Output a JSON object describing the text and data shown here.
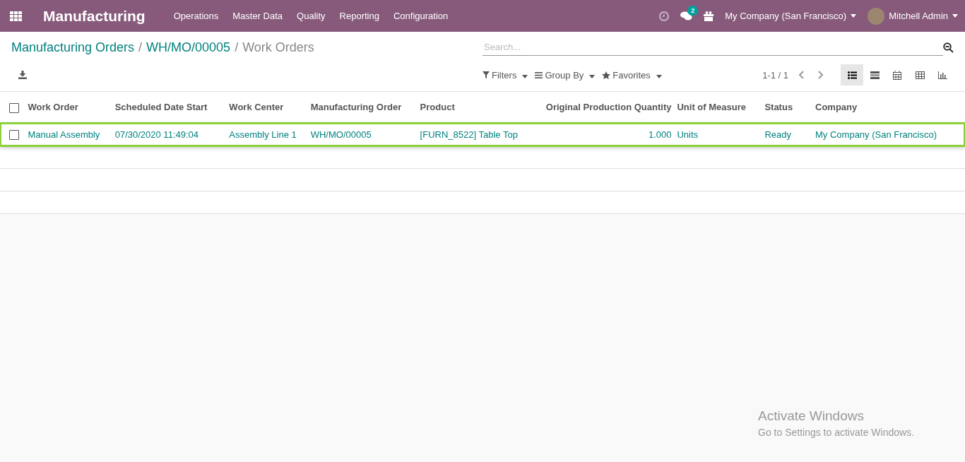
{
  "navbar": {
    "app_name": "Manufacturing",
    "menus": [
      "Operations",
      "Master Data",
      "Quality",
      "Reporting",
      "Configuration"
    ],
    "messages_count": "2",
    "company": "My Company (San Francisco)",
    "user": "Mitchell Admin"
  },
  "breadcrumb_separator": "/",
  "breadcrumb": [
    {
      "label": "Manufacturing Orders",
      "kind": "link"
    },
    {
      "label": "WH/MO/00005",
      "kind": "link"
    },
    {
      "label": "Work Orders",
      "kind": "current"
    }
  ],
  "search": {
    "placeholder": "Search..."
  },
  "filters": [
    {
      "label": "Filters",
      "kind": "filter"
    },
    {
      "label": "Group By",
      "kind": "group"
    },
    {
      "label": "Favorites",
      "kind": "star"
    }
  ],
  "pager": "1-1 / 1",
  "views": [
    {
      "kind": "list",
      "selected": true
    },
    {
      "kind": "kanban",
      "selected": false
    },
    {
      "kind": "calendar",
      "selected": false
    },
    {
      "kind": "pivot",
      "selected": false
    },
    {
      "kind": "graph",
      "selected": false
    }
  ],
  "table": {
    "all_checked": false,
    "columns": [
      {
        "label": "Work Order",
        "kind": "text"
      },
      {
        "label": "Scheduled Date Start",
        "kind": "text"
      },
      {
        "label": "Work Center",
        "kind": "text"
      },
      {
        "label": "Manufacturing Order",
        "kind": "text"
      },
      {
        "label": "Product",
        "kind": "text"
      },
      {
        "label": "Original Production Quantity",
        "kind": "number"
      },
      {
        "label": "Unit of Measure",
        "kind": "text"
      },
      {
        "label": "Status",
        "kind": "text"
      },
      {
        "label": "Company",
        "kind": "text"
      }
    ],
    "rows": [
      {
        "checked": false,
        "highlighted": true,
        "cells": [
          "Manual Assembly",
          "07/30/2020 11:49:04",
          "Assembly Line 1",
          "WH/MO/00005",
          "[FURN_8522] Table Top",
          "1.000",
          "Units",
          "Ready",
          "My Company (San Francisco)"
        ]
      }
    ]
  },
  "os_notice": {
    "title": "Activate Windows",
    "subtitle": "Go to Settings to activate Windows."
  }
}
